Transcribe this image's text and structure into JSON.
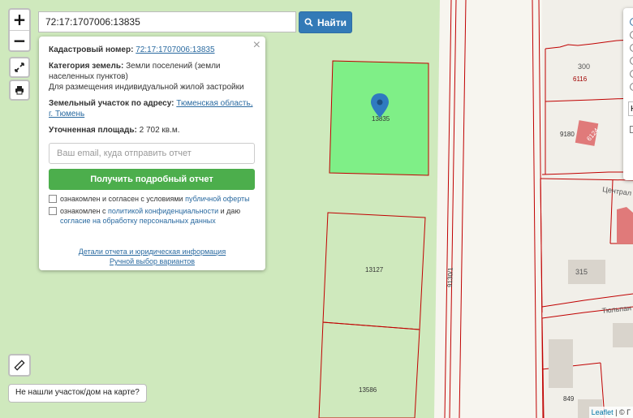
{
  "search": {
    "value": "72:17:1707006:13835",
    "find_label": "Найти"
  },
  "zoom": {
    "in": "+",
    "out": "−"
  },
  "popup": {
    "close": "×",
    "cadastral_label": "Кадастровый номер:",
    "cadastral_value": "72:17:1707006:13835",
    "category_label": "Категория земель:",
    "category_value": "Земли поселений (земли населенных пунктов)",
    "permitted_use": "Для размещения индивидуальной жилой застройки",
    "address_label": "Земельный участок по адресу:",
    "address_value": "Тюменская область, г. Тюмень",
    "area_label": "Уточненная площадь:",
    "area_value": "2 702 кв.м.",
    "email_placeholder": "Ваш email, куда отправить отчет",
    "report_button": "Получить подробный отчет",
    "consent1_text": "ознакомлен и согласен с условиями",
    "consent1_link": "публичной оферты",
    "consent2_text_a": "ознакомлен с",
    "consent2_link_a": "политикой конфиденциальности",
    "consent2_text_b": "и даю",
    "consent2_link_b": "согласие на обработку персональных данных",
    "details_link": "Детали отчета и юридическая информация",
    "manual_link": "Ручной выбор вариантов"
  },
  "not_found_button": "Не нашли участок/дом на карте?",
  "attribution": {
    "leaflet": "Leaflet",
    "rest": "| © Г"
  },
  "map_labels": {
    "selected_parcel": "13835",
    "parcel_13127": "13127",
    "parcel_13586": "13586",
    "road": "9130/1",
    "p300": "300",
    "p6116": "6116",
    "p9180": "9180",
    "p6124": "6124",
    "street1": "Централ",
    "p315": "315",
    "street2": "Тюльпан",
    "p849": "849"
  },
  "layers_input_value": "Н",
  "colors": {
    "accent": "#337ab7",
    "green_button": "#4cae4c",
    "selected_parcel": "#7fef87",
    "parcel_border": "#c00000",
    "marker": "#2f7ac0"
  }
}
